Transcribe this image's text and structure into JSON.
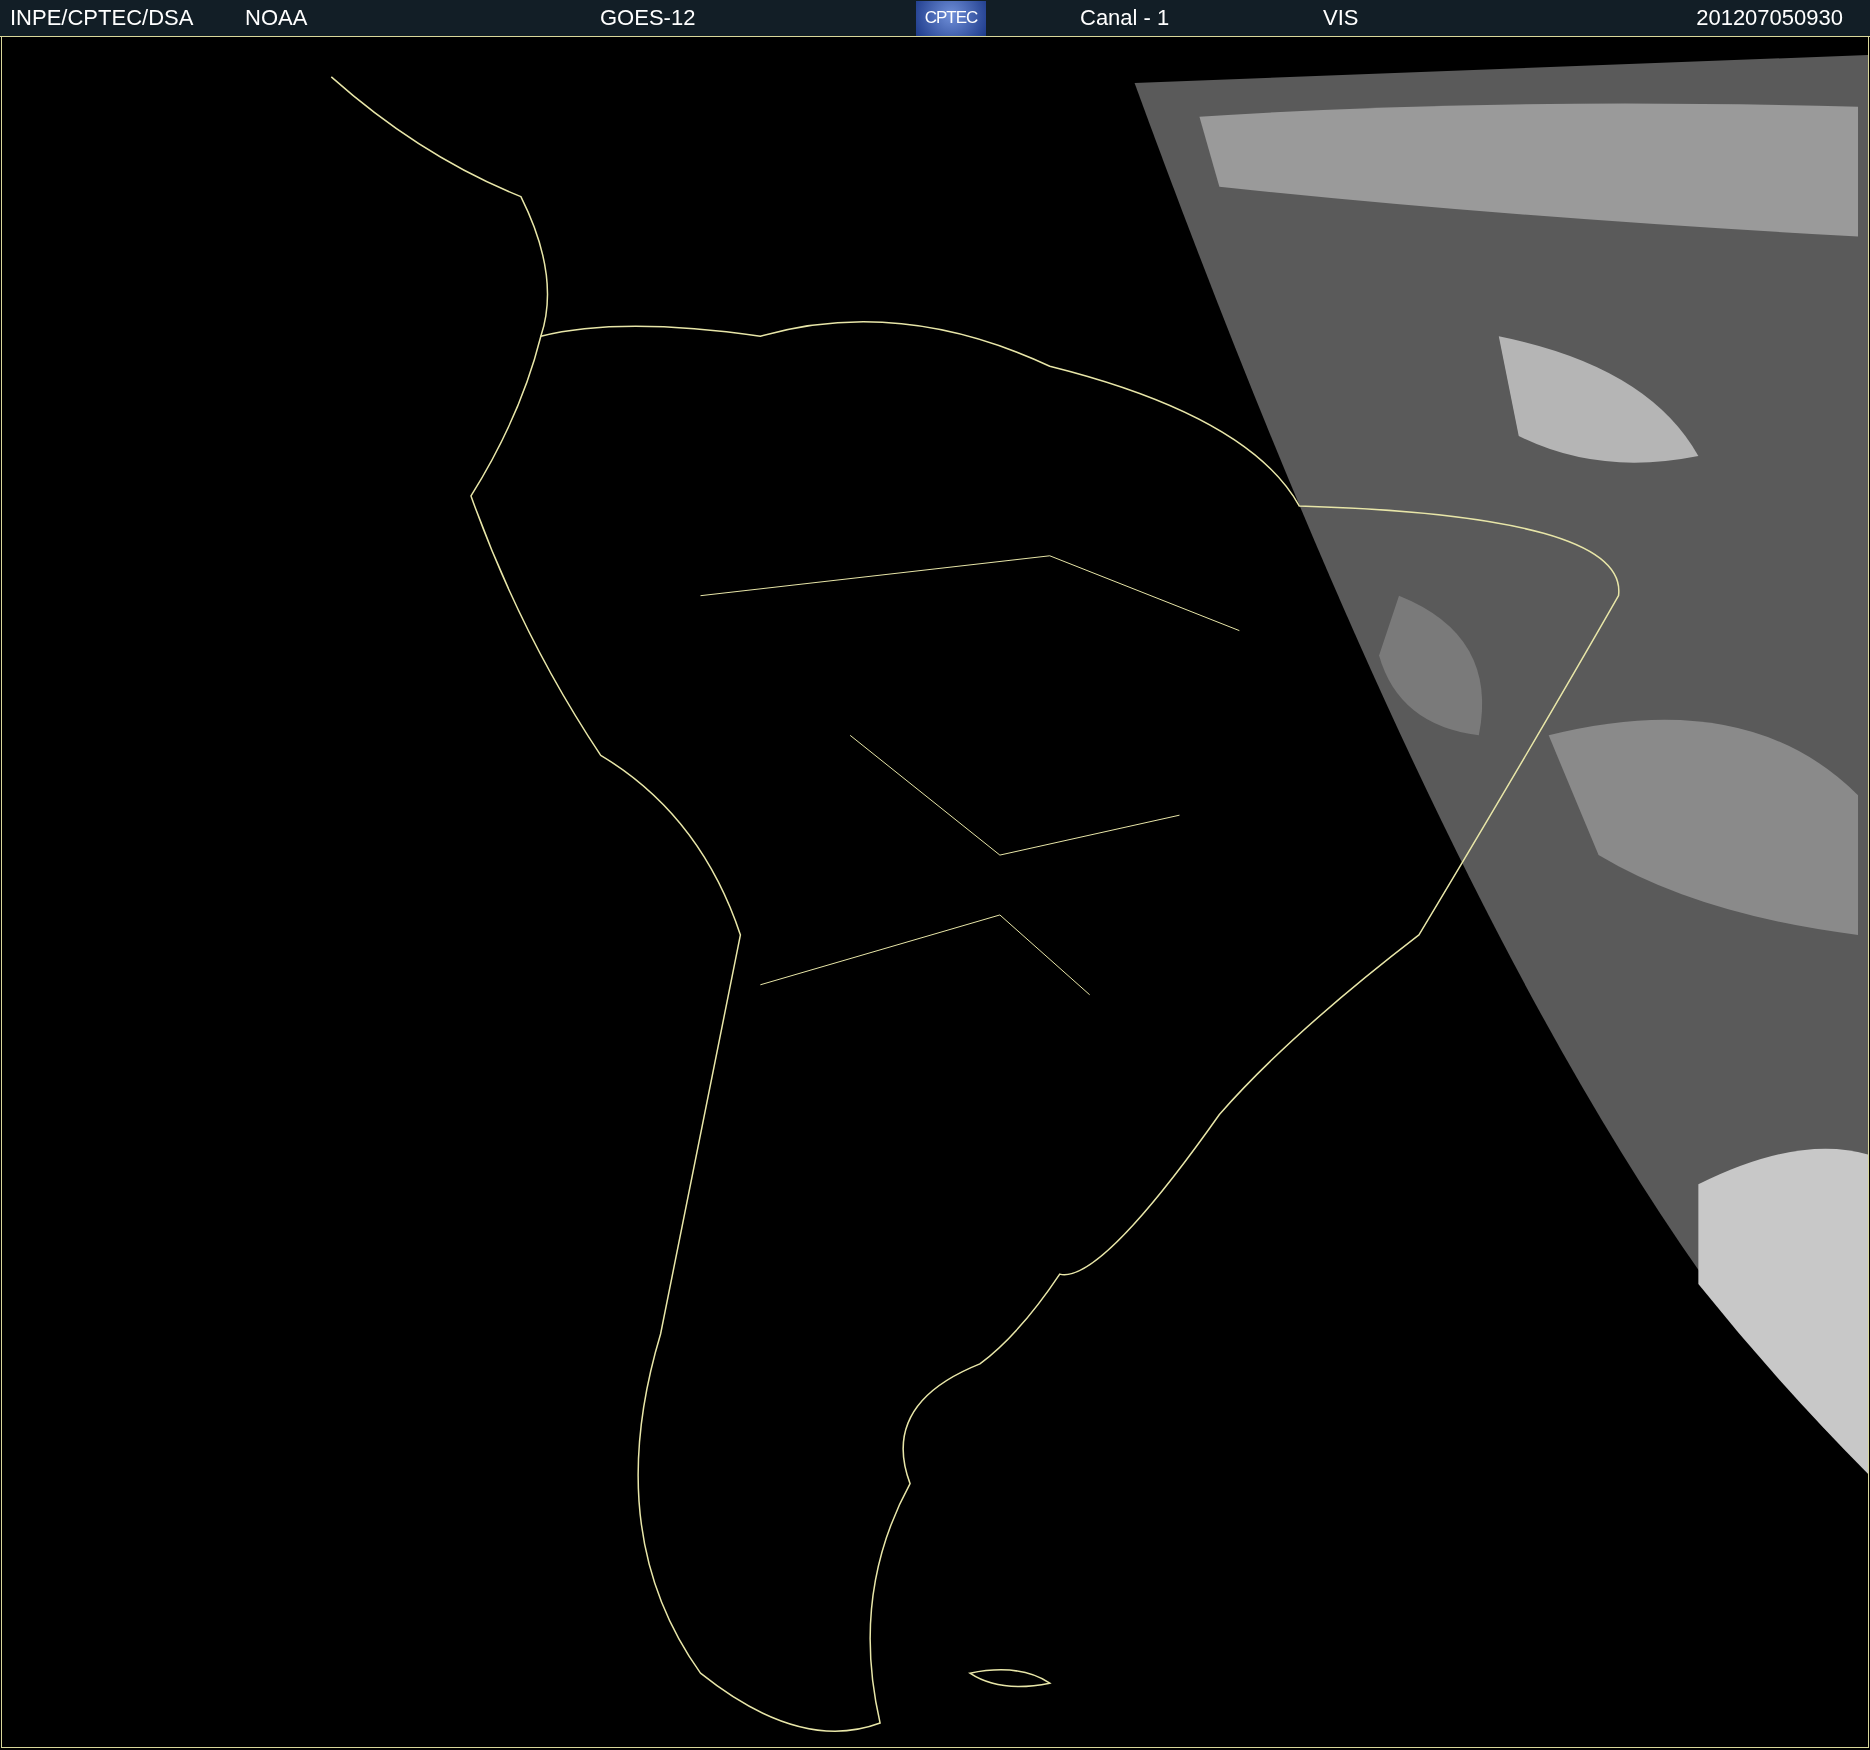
{
  "header": {
    "source": "INPE/CPTEC/DSA",
    "agency": "NOAA",
    "satellite": "GOES-12",
    "logo": "CPTEC",
    "channel": "Canal - 1",
    "band": "VIS",
    "timestamp": "201207050930"
  }
}
